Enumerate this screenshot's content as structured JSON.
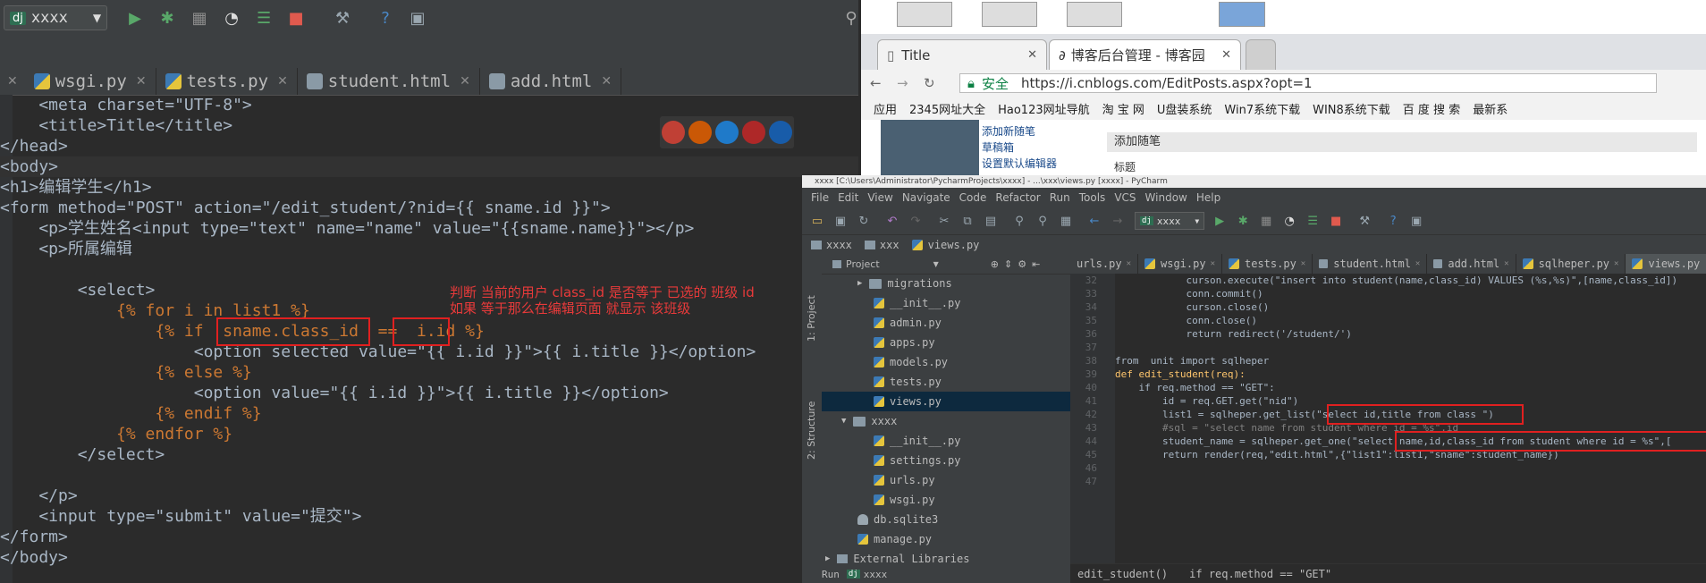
{
  "left_ide": {
    "run_config": "xxxx",
    "run_config_badge": "dj",
    "tabs": [
      {
        "label": "wsgi.py"
      },
      {
        "label": "tests.py"
      },
      {
        "label": "student.html"
      },
      {
        "label": "add.html"
      }
    ],
    "code_lines": [
      "    <meta charset=\"UTF-8\">",
      "    <title>Title</title>",
      "</head>",
      "<body>",
      "<h1>编辑学生</h1>",
      "<form method=\"POST\" action=\"/edit_student/?nid={{ sname.id }}\">",
      "    <p>学生姓名<input type=\"text\" name=\"name\" value=\"{{sname.name}}\"></p>",
      "    <p>所属编辑",
      "",
      "        <select>",
      "            {% for i in list1 %}",
      "                {% if  sname.class_id  ==  i.id %}",
      "                    <option selected value=\"{{ i.id }}\">{{ i.title }}</option>",
      "                {% else %}",
      "                    <option value=\"{{ i.id }}\">{{ i.title }}</option>",
      "                {% endif %}",
      "            {% endfor %}",
      "        </select>",
      "",
      "    </p>",
      "    <input type=\"submit\" value=\"提交\">",
      "</form>",
      "</body>"
    ],
    "annotation_line1": "判断 当前的用户 class_id 是否等于 已选的 班级 id",
    "annotation_line2": "如果 等于那么在编辑页面 就显示 该班级"
  },
  "browser": {
    "tabs": [
      {
        "label": "Title"
      },
      {
        "label": "博客后台管理 - 博客园"
      }
    ],
    "security_label": "安全",
    "url": "https://i.cnblogs.com/EditPosts.aspx?opt=1",
    "bookmarks": [
      "应用",
      "2345网址大全",
      "Hao123网址导航",
      "淘 宝 网",
      "U盘装系统",
      "Win7系统下载",
      "WIN8系统下载",
      "百 度 搜 索",
      "最新系"
    ],
    "sidebar_links": [
      "添加新随笔",
      "草稿箱",
      "设置默认编辑器"
    ],
    "page_heading": "添加随笔",
    "page_label": "标题"
  },
  "right_ide": {
    "title": "xxxx [C:\\Users\\Administrator\\PycharmProjects\\xxxx] - ...\\xxx\\views.py [xxxx] - PyCharm",
    "menu": [
      "File",
      "Edit",
      "View",
      "Navigate",
      "Code",
      "Refactor",
      "Run",
      "Tools",
      "VCS",
      "Window",
      "Help"
    ],
    "run_config": "xxxx",
    "breadcrumb": [
      "xxxx",
      "xxx",
      "views.py"
    ],
    "side_labels": [
      "1: Project",
      "2: Structure"
    ],
    "project_header": "Project",
    "tree": [
      {
        "label": "migrations",
        "type": "folder"
      },
      {
        "label": "__init__.py",
        "type": "py"
      },
      {
        "label": "admin.py",
        "type": "py"
      },
      {
        "label": "apps.py",
        "type": "py"
      },
      {
        "label": "models.py",
        "type": "py"
      },
      {
        "label": "tests.py",
        "type": "py"
      },
      {
        "label": "views.py",
        "type": "py"
      },
      {
        "label": "xxxx",
        "type": "folder"
      },
      {
        "label": "__init__.py",
        "type": "py"
      },
      {
        "label": "settings.py",
        "type": "py"
      },
      {
        "label": "urls.py",
        "type": "py"
      },
      {
        "label": "wsgi.py",
        "type": "py"
      },
      {
        "label": "db.sqlite3",
        "type": "db"
      },
      {
        "label": "manage.py",
        "type": "py"
      },
      {
        "label": "External Libraries",
        "type": "lib"
      }
    ],
    "editor_tabs": [
      "urls.py",
      "wsgi.py",
      "tests.py",
      "student.html",
      "add.html",
      "sqlheper.py",
      "views.py"
    ],
    "line_numbers": [
      "32",
      "33",
      "34",
      "35",
      "36",
      "37",
      "38",
      "39",
      "40",
      "41",
      "42",
      "43",
      "44",
      "45",
      "46",
      "47"
    ],
    "code_lines": [
      "            curson.execute(\"insert into student(name,class_id) VALUES (%s,%s)\",[name,class_id])",
      "            conn.commit()",
      "            curson.close()",
      "            conn.close()",
      "            return redirect('/student/')",
      "",
      "from  unit import sqlheper",
      "def edit_student(req):",
      "    if req.method == \"GET\":",
      "        id = req.GET.get(\"nid\")",
      "        list1 = sqlheper.get_list(\"select id,title from class \")",
      "        #sql = \"select name from student where id = %s\",id",
      "        student_name = sqlheper.get_one(\"select name,id,class_id from student where id = %s\",[",
      "        return render(req,\"edit.html\",{\"list1\":list1,\"sname\":student_name})",
      "",
      ""
    ],
    "status_items": [
      "edit_student()",
      "if req.method == \"GET\""
    ],
    "run_label": "Run",
    "run_config_bottom": "xxxx"
  }
}
